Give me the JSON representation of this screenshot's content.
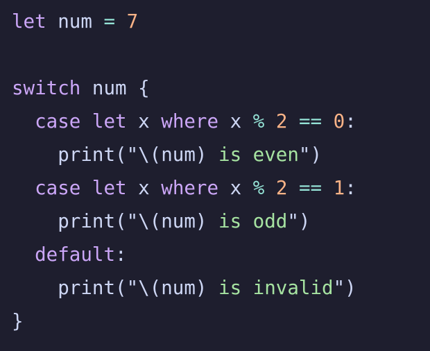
{
  "colors": {
    "background": "#1e1e2e",
    "keyword": "#cba6f7",
    "text": "#cdd6f4",
    "operator": "#94e2d5",
    "number": "#fab387",
    "string": "#a6e3a1"
  },
  "code": {
    "lines": [
      [
        {
          "text": "let",
          "kind": "keyword"
        },
        {
          "text": " num ",
          "kind": "text"
        },
        {
          "text": "=",
          "kind": "operator"
        },
        {
          "text": " ",
          "kind": "text"
        },
        {
          "text": "7",
          "kind": "number"
        }
      ],
      [],
      [
        {
          "text": "switch",
          "kind": "keyword"
        },
        {
          "text": " num {",
          "kind": "text"
        }
      ],
      [
        {
          "text": "  ",
          "kind": "text"
        },
        {
          "text": "case",
          "kind": "keyword"
        },
        {
          "text": " ",
          "kind": "text"
        },
        {
          "text": "let",
          "kind": "keyword"
        },
        {
          "text": " x ",
          "kind": "text"
        },
        {
          "text": "where",
          "kind": "keyword"
        },
        {
          "text": " x ",
          "kind": "text"
        },
        {
          "text": "%",
          "kind": "operator"
        },
        {
          "text": " ",
          "kind": "text"
        },
        {
          "text": "2",
          "kind": "number"
        },
        {
          "text": " ",
          "kind": "text"
        },
        {
          "text": "==",
          "kind": "operator"
        },
        {
          "text": " ",
          "kind": "text"
        },
        {
          "text": "0",
          "kind": "number"
        },
        {
          "text": ":",
          "kind": "text"
        }
      ],
      [
        {
          "text": "    print(\"\\(num) ",
          "kind": "text"
        },
        {
          "text": "is even",
          "kind": "string"
        },
        {
          "text": "\")",
          "kind": "text"
        }
      ],
      [
        {
          "text": "  ",
          "kind": "text"
        },
        {
          "text": "case",
          "kind": "keyword"
        },
        {
          "text": " ",
          "kind": "text"
        },
        {
          "text": "let",
          "kind": "keyword"
        },
        {
          "text": " x ",
          "kind": "text"
        },
        {
          "text": "where",
          "kind": "keyword"
        },
        {
          "text": " x ",
          "kind": "text"
        },
        {
          "text": "%",
          "kind": "operator"
        },
        {
          "text": " ",
          "kind": "text"
        },
        {
          "text": "2",
          "kind": "number"
        },
        {
          "text": " ",
          "kind": "text"
        },
        {
          "text": "==",
          "kind": "operator"
        },
        {
          "text": " ",
          "kind": "text"
        },
        {
          "text": "1",
          "kind": "number"
        },
        {
          "text": ":",
          "kind": "text"
        }
      ],
      [
        {
          "text": "    print(\"\\(num) ",
          "kind": "text"
        },
        {
          "text": "is odd",
          "kind": "string"
        },
        {
          "text": "\")",
          "kind": "text"
        }
      ],
      [
        {
          "text": "  ",
          "kind": "text"
        },
        {
          "text": "default",
          "kind": "keyword"
        },
        {
          "text": ":",
          "kind": "text"
        }
      ],
      [
        {
          "text": "    print(\"\\(num) ",
          "kind": "text"
        },
        {
          "text": "is invalid",
          "kind": "string"
        },
        {
          "text": "\")",
          "kind": "text"
        }
      ],
      [
        {
          "text": "}",
          "kind": "text"
        }
      ]
    ]
  }
}
